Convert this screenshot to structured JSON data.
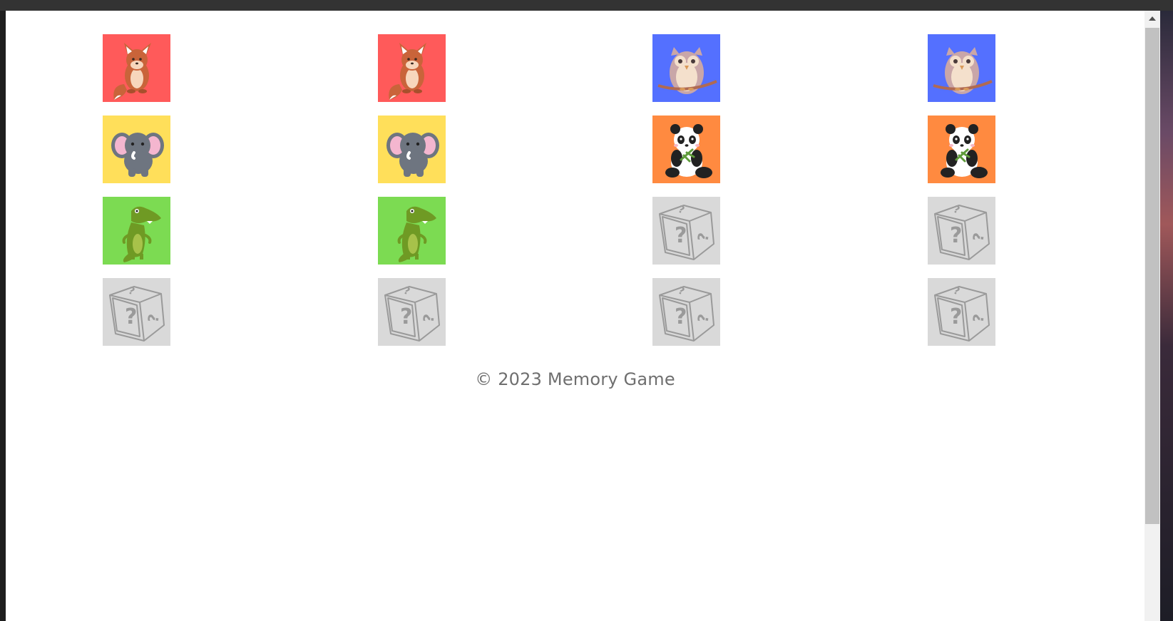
{
  "board": {
    "cards": [
      {
        "animal": "fox",
        "state": "revealed",
        "color": "#ff5a5a"
      },
      {
        "animal": "fox",
        "state": "revealed",
        "color": "#ff5a5a"
      },
      {
        "animal": "owl",
        "state": "revealed",
        "color": "#5470ff"
      },
      {
        "animal": "owl",
        "state": "revealed",
        "color": "#5470ff"
      },
      {
        "animal": "elephant",
        "state": "revealed",
        "color": "#ffdf5a"
      },
      {
        "animal": "elephant",
        "state": "revealed",
        "color": "#ffdf5a"
      },
      {
        "animal": "panda",
        "state": "revealed",
        "color": "#ff8a40"
      },
      {
        "animal": "panda",
        "state": "revealed",
        "color": "#ff8a40"
      },
      {
        "animal": "crocodile",
        "state": "revealed",
        "color": "#7cdb52"
      },
      {
        "animal": "crocodile",
        "state": "revealed",
        "color": "#7cdb52"
      },
      {
        "animal": "mystery-box",
        "state": "hidden",
        "color": "#d9d9d9"
      },
      {
        "animal": "mystery-box",
        "state": "hidden",
        "color": "#d9d9d9"
      },
      {
        "animal": "mystery-box",
        "state": "hidden",
        "color": "#d9d9d9"
      },
      {
        "animal": "mystery-box",
        "state": "hidden",
        "color": "#d9d9d9"
      },
      {
        "animal": "mystery-box",
        "state": "hidden",
        "color": "#d9d9d9"
      },
      {
        "animal": "mystery-box",
        "state": "hidden",
        "color": "#d9d9d9"
      }
    ]
  },
  "footer": {
    "text": "© 2023 Memory Game"
  }
}
